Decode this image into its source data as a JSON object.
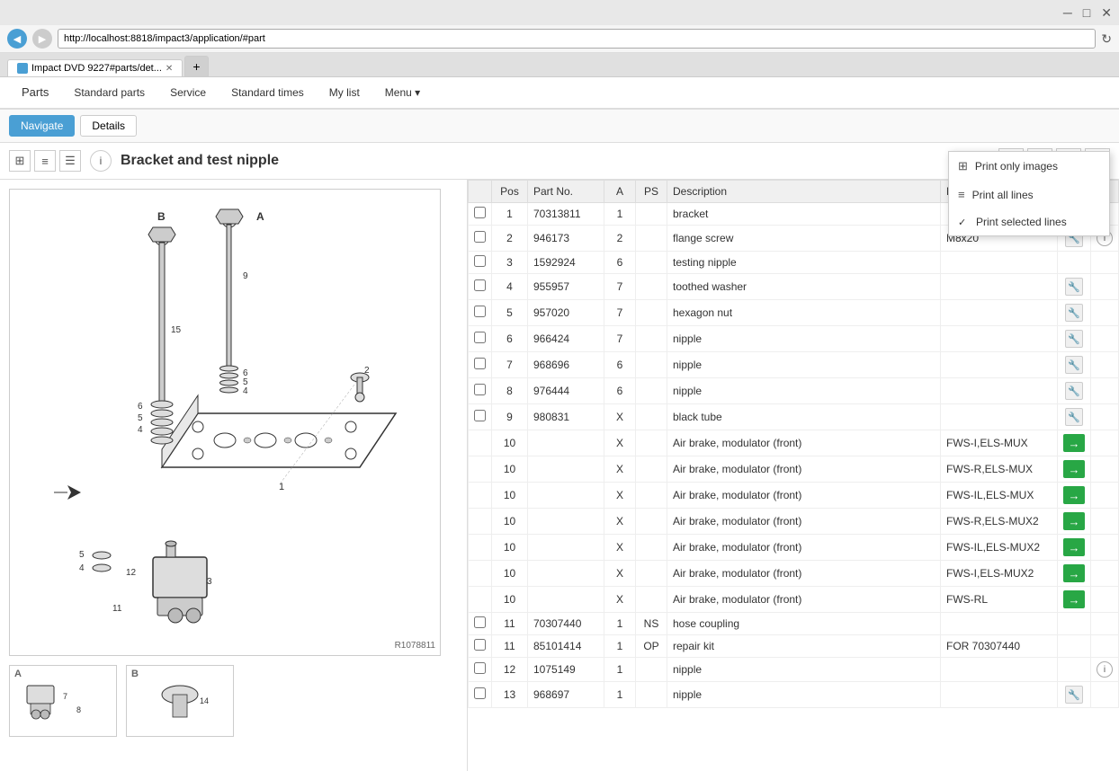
{
  "browser": {
    "url": "http://localhost:8818/impact3/application/#part",
    "tab_title": "Impact DVD 9227#parts/det...",
    "tab_icon": "browser-icon",
    "back_btn": "◀",
    "forward_btn": "▶",
    "refresh_btn": "↻",
    "controls": [
      "─",
      "□",
      "✕"
    ]
  },
  "nav": {
    "items": [
      {
        "label": "Parts",
        "active": true
      },
      {
        "label": "Standard parts"
      },
      {
        "label": "Service"
      },
      {
        "label": "Standard times"
      },
      {
        "label": "My list"
      },
      {
        "label": "Menu ▾"
      }
    ]
  },
  "toolbar": {
    "navigate_label": "Navigate",
    "details_label": "Details"
  },
  "page": {
    "title": "Bracket and test nipple",
    "view_icons": [
      "⊞",
      "≡",
      "☰"
    ],
    "info_icon": "i",
    "header_actions": [
      "◀",
      "🛒",
      "⧉",
      "🖨"
    ]
  },
  "print_menu": {
    "items": [
      {
        "label": "Print only images",
        "icon": "⊞",
        "checked": false
      },
      {
        "label": "Print all lines",
        "icon": "≡",
        "checked": false
      },
      {
        "label": "Print selected lines",
        "icon": "≡",
        "checked": true
      }
    ]
  },
  "table": {
    "columns": [
      "",
      "Pos",
      "Part No.",
      "A",
      "PS",
      "Description",
      "Notes",
      "",
      ""
    ],
    "rows": [
      {
        "pos": "1",
        "partno": "70313811",
        "a": "1",
        "ps": "",
        "desc": "bracket",
        "notes": "",
        "has_wrench": false,
        "has_arrow": false,
        "has_info": false,
        "checkable": true
      },
      {
        "pos": "2",
        "partno": "946173",
        "a": "2",
        "ps": "",
        "desc": "flange screw",
        "notes": "M8x20",
        "has_wrench": true,
        "has_arrow": false,
        "has_info": true,
        "checkable": true
      },
      {
        "pos": "3",
        "partno": "1592924",
        "a": "6",
        "ps": "",
        "desc": "testing nipple",
        "notes": "",
        "has_wrench": false,
        "has_arrow": false,
        "has_info": false,
        "checkable": true
      },
      {
        "pos": "4",
        "partno": "955957",
        "a": "7",
        "ps": "",
        "desc": "toothed washer",
        "notes": "",
        "has_wrench": true,
        "has_arrow": false,
        "has_info": false,
        "checkable": true
      },
      {
        "pos": "5",
        "partno": "957020",
        "a": "7",
        "ps": "",
        "desc": "hexagon nut",
        "notes": "",
        "has_wrench": true,
        "has_arrow": false,
        "has_info": false,
        "checkable": true
      },
      {
        "pos": "6",
        "partno": "966424",
        "a": "7",
        "ps": "",
        "desc": "nipple",
        "notes": "",
        "has_wrench": true,
        "has_arrow": false,
        "has_info": false,
        "checkable": true
      },
      {
        "pos": "7",
        "partno": "968696",
        "a": "6",
        "ps": "",
        "desc": "nipple",
        "notes": "",
        "has_wrench": true,
        "has_arrow": false,
        "has_info": false,
        "checkable": true
      },
      {
        "pos": "8",
        "partno": "976444",
        "a": "6",
        "ps": "",
        "desc": "nipple",
        "notes": "",
        "has_wrench": true,
        "has_arrow": false,
        "has_info": false,
        "checkable": true
      },
      {
        "pos": "9",
        "partno": "980831",
        "a": "X",
        "ps": "",
        "desc": "black tube",
        "notes": "",
        "has_wrench": true,
        "has_arrow": false,
        "has_info": false,
        "checkable": true
      },
      {
        "pos": "10",
        "partno": "",
        "a": "X",
        "ps": "",
        "desc": "Air brake, modulator (front)",
        "notes": "FWS-I,ELS-MUX",
        "has_wrench": false,
        "has_arrow": true,
        "has_info": false,
        "checkable": false
      },
      {
        "pos": "10",
        "partno": "",
        "a": "X",
        "ps": "",
        "desc": "Air brake, modulator (front)",
        "notes": "FWS-R,ELS-MUX",
        "has_wrench": false,
        "has_arrow": true,
        "has_info": false,
        "checkable": false
      },
      {
        "pos": "10",
        "partno": "",
        "a": "X",
        "ps": "",
        "desc": "Air brake, modulator (front)",
        "notes": "FWS-IL,ELS-MUX",
        "has_wrench": false,
        "has_arrow": true,
        "has_info": false,
        "checkable": false
      },
      {
        "pos": "10",
        "partno": "",
        "a": "X",
        "ps": "",
        "desc": "Air brake, modulator (front)",
        "notes": "FWS-R,ELS-MUX2",
        "has_wrench": false,
        "has_arrow": true,
        "has_info": false,
        "checkable": false
      },
      {
        "pos": "10",
        "partno": "",
        "a": "X",
        "ps": "",
        "desc": "Air brake, modulator (front)",
        "notes": "FWS-IL,ELS-MUX2",
        "has_wrench": false,
        "has_arrow": true,
        "has_info": false,
        "checkable": false
      },
      {
        "pos": "10",
        "partno": "",
        "a": "X",
        "ps": "",
        "desc": "Air brake, modulator (front)",
        "notes": "FWS-I,ELS-MUX2",
        "has_wrench": false,
        "has_arrow": true,
        "has_info": false,
        "checkable": false
      },
      {
        "pos": "10",
        "partno": "",
        "a": "X",
        "ps": "",
        "desc": "Air brake, modulator (front)",
        "notes": "FWS-RL",
        "has_wrench": false,
        "has_arrow": true,
        "has_info": false,
        "checkable": false
      },
      {
        "pos": "11",
        "partno": "70307440",
        "a": "1",
        "ps": "NS",
        "desc": "hose coupling",
        "notes": "",
        "has_wrench": false,
        "has_arrow": false,
        "has_info": false,
        "checkable": true
      },
      {
        "pos": "11",
        "partno": "85101414",
        "a": "1",
        "ps": "OP",
        "desc": "repair kit",
        "notes": "FOR 70307440",
        "has_wrench": false,
        "has_arrow": false,
        "has_info": false,
        "checkable": true
      },
      {
        "pos": "12",
        "partno": "1075149",
        "a": "1",
        "ps": "",
        "desc": "nipple",
        "notes": "",
        "has_wrench": false,
        "has_arrow": false,
        "has_info": true,
        "checkable": true
      },
      {
        "pos": "13",
        "partno": "968697",
        "a": "1",
        "ps": "",
        "desc": "nipple",
        "notes": "",
        "has_wrench": true,
        "has_arrow": false,
        "has_info": false,
        "checkable": true
      }
    ]
  },
  "diagram": {
    "ref": "R1078811",
    "thumbnails": [
      {
        "label": "A",
        "parts": "7, 8"
      },
      {
        "label": "B",
        "parts": "14"
      }
    ]
  }
}
